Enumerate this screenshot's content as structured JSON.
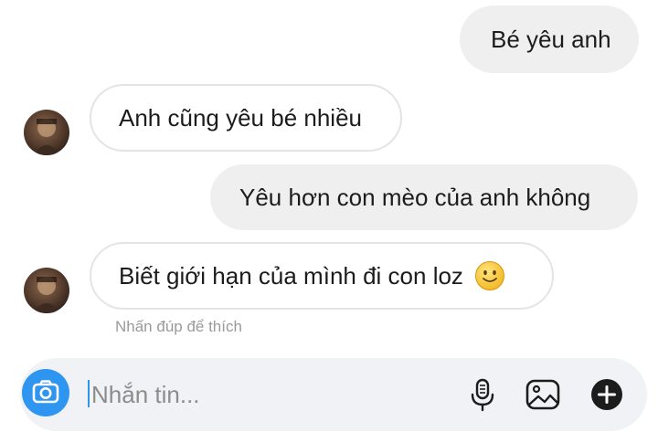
{
  "messages": [
    {
      "direction": "sent",
      "text": "Bé yêu anh"
    },
    {
      "direction": "received",
      "text": "Anh cũng yêu bé nhiều"
    },
    {
      "direction": "sent",
      "text": "Yêu hơn con mèo của anh không"
    },
    {
      "direction": "received",
      "text": "Biết giới hạn của mình đi con loz",
      "emoji": "slightly-smiling-face-icon"
    }
  ],
  "double_tap_hint": "Nhấn đúp để thích",
  "composer": {
    "placeholder": "Nhắn tin...",
    "value": "",
    "icons": [
      "camera-icon",
      "microphone-icon",
      "gallery-icon",
      "plus-icon"
    ]
  },
  "colors": {
    "accent": "#2e95f0",
    "sent_bubble": "#efefef",
    "received_border": "#e4e4e4",
    "hint_text": "#9a9a9a",
    "composer_bg": "#f1f2f5"
  }
}
